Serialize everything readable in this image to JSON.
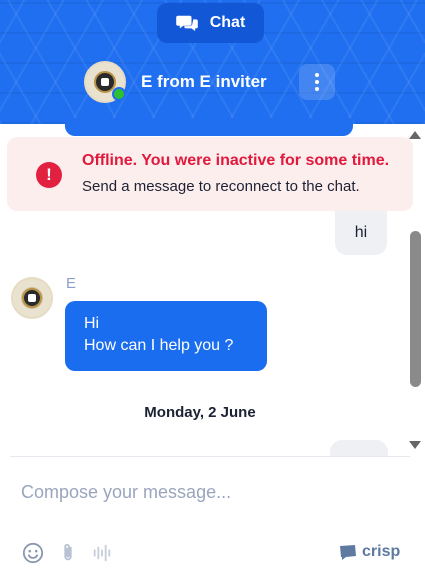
{
  "header": {
    "chat_tab_label": "Chat",
    "agent_name": "E from E inviter",
    "agent_status": "online",
    "menu_icon": "more-vertical-icon"
  },
  "offline_banner": {
    "title": "Offline. You were inactive for some time.",
    "message": "Send a message to reconnect to the chat."
  },
  "messages": [
    {
      "from": "user",
      "text": "hi"
    },
    {
      "from": "operator",
      "author": "E",
      "lines": [
        "Hi",
        "How can I help you ?"
      ]
    }
  ],
  "date_separator": "Monday, 2 June",
  "composer": {
    "placeholder": "Compose your message..."
  },
  "brand_label": "crisp",
  "colors": {
    "header_blue": "#1f6ff0",
    "operator_bubble": "#1a6dee",
    "offline_red": "#e0193d",
    "online_green": "#2ec02e"
  }
}
